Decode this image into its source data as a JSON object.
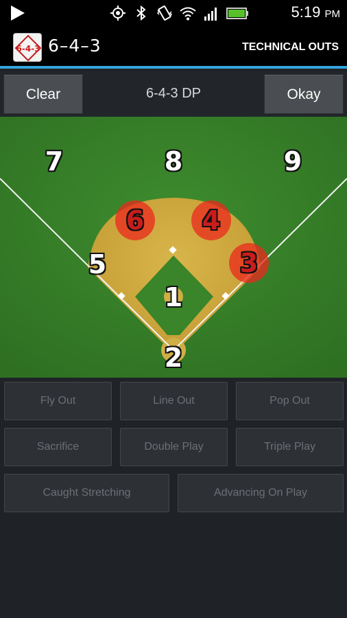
{
  "status_bar": {
    "time": "5:19",
    "ampm": "PM",
    "icons": [
      "play-icon",
      "gps-icon",
      "bluetooth-icon",
      "vibrate-icon",
      "wifi-icon",
      "signal-icon",
      "battery-icon"
    ]
  },
  "action_bar": {
    "logo_text": "6-4-3",
    "title": "6–4–3",
    "action": "TECHNICAL OUTS",
    "accent_color": "#33a3dc"
  },
  "toolbar": {
    "clear_label": "Clear",
    "play": "6-4-3 DP",
    "okay_label": "Okay"
  },
  "field": {
    "positions": [
      {
        "num": "7",
        "selected": false
      },
      {
        "num": "8",
        "selected": false
      },
      {
        "num": "9",
        "selected": false
      },
      {
        "num": "6",
        "selected": true
      },
      {
        "num": "4",
        "selected": true
      },
      {
        "num": "5",
        "selected": false
      },
      {
        "num": "3",
        "selected": true
      },
      {
        "num": "1",
        "selected": false
      },
      {
        "num": "2",
        "selected": false
      }
    ],
    "selected_color": "#e8281e"
  },
  "out_buttons": {
    "fly_out": "Fly Out",
    "line_out": "Line Out",
    "pop_out": "Pop Out",
    "sacrifice": "Sacrifice",
    "double_play": "Double Play",
    "triple_play": "Triple Play",
    "caught_stretching": "Caught Stretching",
    "advancing_on_play": "Advancing On Play"
  }
}
